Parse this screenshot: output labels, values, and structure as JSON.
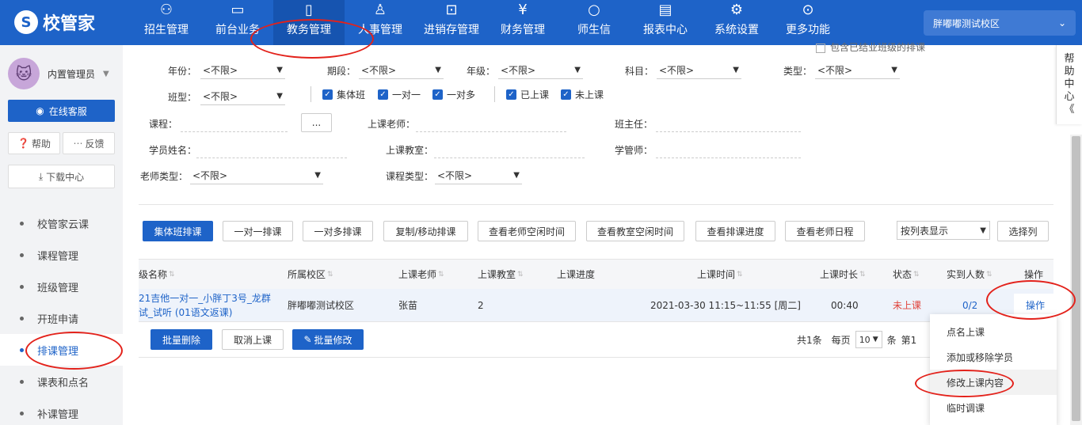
{
  "app": {
    "logo": "校管家"
  },
  "nav": [
    {
      "label": "招生管理",
      "icon": "user-add-icon"
    },
    {
      "label": "前台业务",
      "icon": "monitor-icon"
    },
    {
      "label": "教务管理",
      "icon": "book-icon"
    },
    {
      "label": "人事管理",
      "icon": "person-icon"
    },
    {
      "label": "进销存管理",
      "icon": "inbox-icon"
    },
    {
      "label": "财务管理",
      "icon": "money-icon"
    },
    {
      "label": "师生信",
      "icon": "chat-icon"
    },
    {
      "label": "报表中心",
      "icon": "report-icon"
    },
    {
      "label": "系统设置",
      "icon": "gear-icon"
    },
    {
      "label": "更多功能",
      "icon": "more-icon"
    }
  ],
  "campus": "胖嘟嘟测试校区",
  "sidebar": {
    "user": "内置管理员",
    "service": "在线客服",
    "help": "帮助",
    "feedback": "反馈",
    "download": "下载中心",
    "menu": [
      "校管家云课",
      "课程管理",
      "班级管理",
      "开班申请",
      "排课管理",
      "课表和点名",
      "补课管理"
    ]
  },
  "filters": {
    "top_hint": "包含已结业班级的排课",
    "year_label": "年份：",
    "year": "<不限>",
    "term_label": "期段：",
    "term": "<不限>",
    "grade_label": "年级：",
    "grade": "<不限>",
    "subject_label": "科目：",
    "subject": "<不限>",
    "type_label": "类型：",
    "type": "<不限>",
    "classtype_label": "班型：",
    "classtype": "<不限>",
    "checks": [
      "集体班",
      "一对一",
      "一对多",
      "已上课",
      "未上课"
    ],
    "course_label": "课程：",
    "course_btn": "...",
    "teacher_label": "上课老师：",
    "headteacher_label": "班主任：",
    "student_label": "学员姓名：",
    "room_label": "上课教室：",
    "manager_label": "学管师：",
    "teachertype_label": "老师类型：",
    "teachertype": "<不限>",
    "coursetype_label": "课程类型：",
    "coursetype": "<不限>"
  },
  "toolbar": {
    "buttons": [
      "集体班排课",
      "一对一排课",
      "一对多排课",
      "复制/移动排课",
      "查看老师空闲时间",
      "查看教室空闲时间",
      "查看排课进度",
      "查看老师日程"
    ],
    "view_select": "按列表显示",
    "choose_cols": "选择列"
  },
  "table": {
    "headers": [
      "级名称",
      "所属校区",
      "上课老师",
      "上课教室",
      "上课进度",
      "上课时间",
      "上课时长",
      "状态",
      "实到人数",
      "操作"
    ],
    "row": {
      "name_line1": "21吉他一对一_小胖丁3号_龙群",
      "name_line2": "试_试听 (01语文返课)",
      "campus": "胖嘟嘟测试校区",
      "teacher": "张苗",
      "room": "2",
      "time": "2021-03-30 11:15~11:55 [周二]",
      "duration": "00:40",
      "status": "未上课",
      "attendance": "0/2",
      "action": "操作"
    }
  },
  "bottom": {
    "batch_delete": "批量删除",
    "cancel": "取消上课",
    "batch_edit": "批量修改",
    "total": "共1条",
    "per_page_label": "每页",
    "per_page": "10",
    "unit": "条",
    "page": "第1"
  },
  "dropdown": [
    "点名上课",
    "添加或移除学员",
    "修改上课内容",
    "临时调课"
  ],
  "help_center": [
    "帮",
    "助",
    "中",
    "心",
    "《"
  ]
}
